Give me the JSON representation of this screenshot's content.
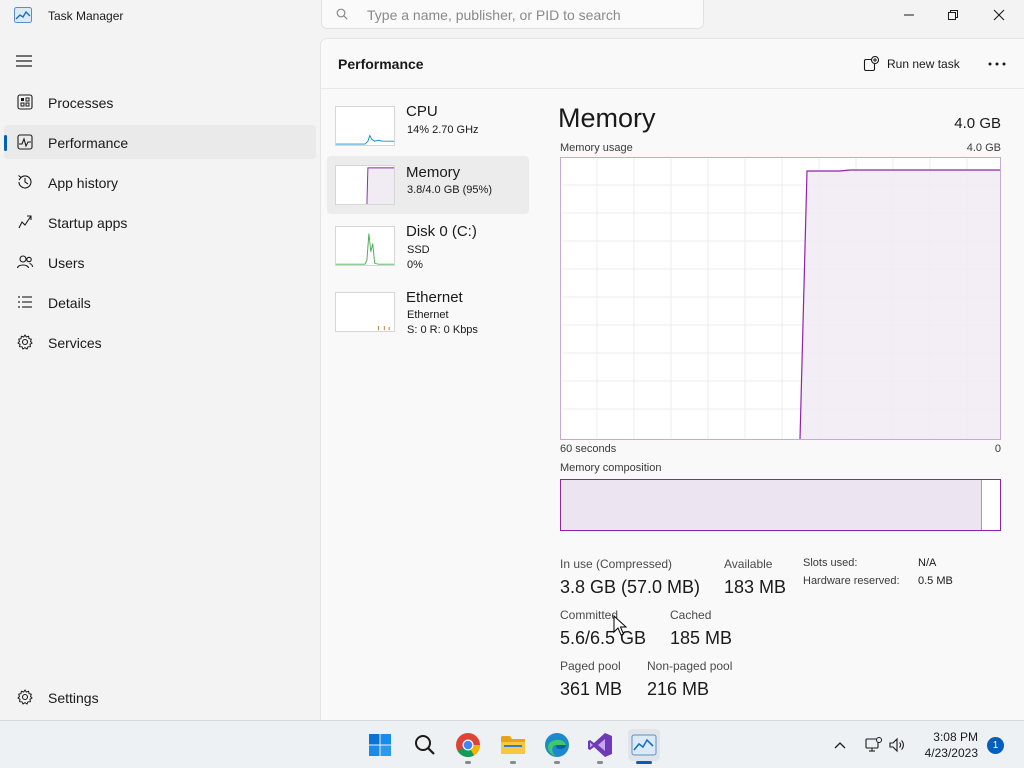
{
  "window": {
    "title": "Task Manager",
    "search_placeholder": "Type a name, publisher, or PID to search"
  },
  "sidebar": {
    "items": [
      {
        "label": "Processes",
        "icon": "processes-icon"
      },
      {
        "label": "Performance",
        "icon": "performance-icon",
        "active": true
      },
      {
        "label": "App history",
        "icon": "history-icon"
      },
      {
        "label": "Startup apps",
        "icon": "startup-icon"
      },
      {
        "label": "Users",
        "icon": "users-icon"
      },
      {
        "label": "Details",
        "icon": "details-icon"
      },
      {
        "label": "Services",
        "icon": "services-icon"
      }
    ],
    "settings_label": "Settings"
  },
  "header": {
    "title": "Performance",
    "run_new_task": "Run new task"
  },
  "devices": [
    {
      "name": "CPU",
      "line1": "14%  2.70 GHz",
      "line2": ""
    },
    {
      "name": "Memory",
      "line1": "3.8/4.0 GB (95%)",
      "line2": ""
    },
    {
      "name": "Disk 0 (C:)",
      "line1": "SSD",
      "line2": "0%"
    },
    {
      "name": "Ethernet",
      "line1": "Ethernet",
      "line2": "S: 0  R: 0 Kbps"
    }
  ],
  "detail": {
    "title": "Memory",
    "total": "4.0 GB",
    "usage_label": "Memory usage",
    "usage_max": "4.0 GB",
    "axis_left": "60 seconds",
    "axis_right": "0",
    "composition_label": "Memory composition",
    "composition_in_use_fraction": 0.96,
    "stats": {
      "in_use_label": "In use (Compressed)",
      "in_use_value": "3.8 GB (57.0 MB)",
      "available_label": "Available",
      "available_value": "183 MB",
      "committed_label": "Committed",
      "committed_value": "5.6/6.5 GB",
      "cached_label": "Cached",
      "cached_value": "185 MB",
      "paged_label": "Paged pool",
      "paged_value": "361 MB",
      "nonpaged_label": "Non-paged pool",
      "nonpaged_value": "216 MB",
      "slots_label": "Slots used:",
      "slots_value": "N/A",
      "hw_reserved_label": "Hardware reserved:",
      "hw_reserved_value": "0.5 MB"
    }
  },
  "taskbar": {
    "apps": [
      "windows-start-icon",
      "search-icon",
      "chrome-icon",
      "file-explorer-icon",
      "edge-icon",
      "visual-studio-icon",
      "task-manager-icon"
    ],
    "time": "3:08 PM",
    "date": "4/23/2023",
    "notification_count": "1"
  },
  "colors": {
    "accent": "#005fb8",
    "memory": "#8e24aa",
    "cpu": "#1890c8",
    "disk": "#4caf50",
    "ethernet": "#c87d3c"
  }
}
